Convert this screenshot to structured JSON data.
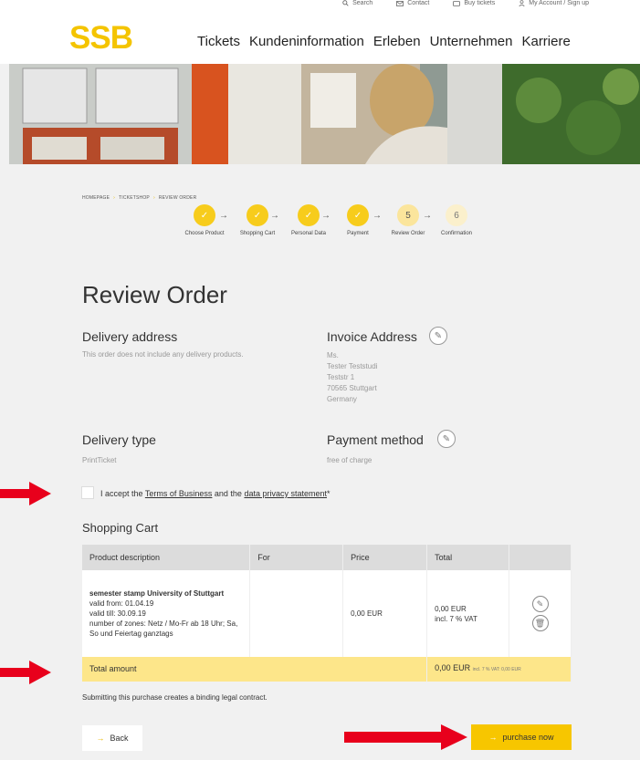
{
  "utility_nav": [
    {
      "icon": "search-icon",
      "label": "Search"
    },
    {
      "icon": "mail-icon",
      "label": "Contact"
    },
    {
      "icon": "ticket-icon",
      "label": "Buy tickets"
    },
    {
      "icon": "user-icon",
      "label": "My Account / Sign up"
    }
  ],
  "logo": "SSB",
  "main_nav": [
    "Tickets",
    "Kundeninformation",
    "Erleben",
    "Unternehmen",
    "Karriere"
  ],
  "breadcrumb": [
    "HOMEPAGE",
    "TICKETSHOP",
    "REVIEW ORDER"
  ],
  "steps": [
    {
      "mark": "✓",
      "label": "Choose Product",
      "state": "done"
    },
    {
      "mark": "✓",
      "label": "Shopping Cart",
      "state": "done"
    },
    {
      "mark": "✓",
      "label": "Personal Data",
      "state": "done"
    },
    {
      "mark": "✓",
      "label": "Payment",
      "state": "done"
    },
    {
      "mark": "5",
      "label": "Review Order",
      "state": "current"
    },
    {
      "mark": "6",
      "label": "Confirmation",
      "state": "future"
    }
  ],
  "page_title": "Review Order",
  "delivery_address": {
    "title": "Delivery address",
    "text": "This order does not include any delivery products."
  },
  "invoice_address": {
    "title": "Invoice Address",
    "lines": [
      "Ms.",
      "Tester Teststudi",
      "Teststr 1",
      "70565 Stuttgart",
      "Germany"
    ]
  },
  "delivery_type": {
    "title": "Delivery type",
    "value": "PrintTicket"
  },
  "payment_method": {
    "title": "Payment method",
    "value": "free of charge"
  },
  "accept": {
    "prefix": "I accept the ",
    "terms": "Terms of Business",
    "middle": " and the ",
    "privacy": "data privacy statement",
    "suffix": "*"
  },
  "cart": {
    "title": "Shopping Cart",
    "headers": [
      "Product description",
      "For",
      "Price",
      "Total"
    ],
    "item": {
      "name": "semester stamp University of Stuttgart",
      "details": [
        "valid from: 01.04.19",
        "valid till: 30.09.19",
        "number of zones: Netz / Mo-Fr ab 18 Uhr; Sa, So und Feiertag ganztags"
      ],
      "for": "",
      "price": "0,00 EUR",
      "total": "0,00 EUR",
      "vat": "incl. 7 % VAT"
    },
    "total_label": "Total amount",
    "total_value": "0,00 EUR",
    "total_vat": "incl. 7 % VAT: 0,00 EUR"
  },
  "contract_note": "Submitting this purchase creates a binding legal contract.",
  "back_label": "Back",
  "purchase_label": "purchase now",
  "colors": {
    "accent": "#f7c600",
    "annotation_arrow": "#e8001c"
  }
}
